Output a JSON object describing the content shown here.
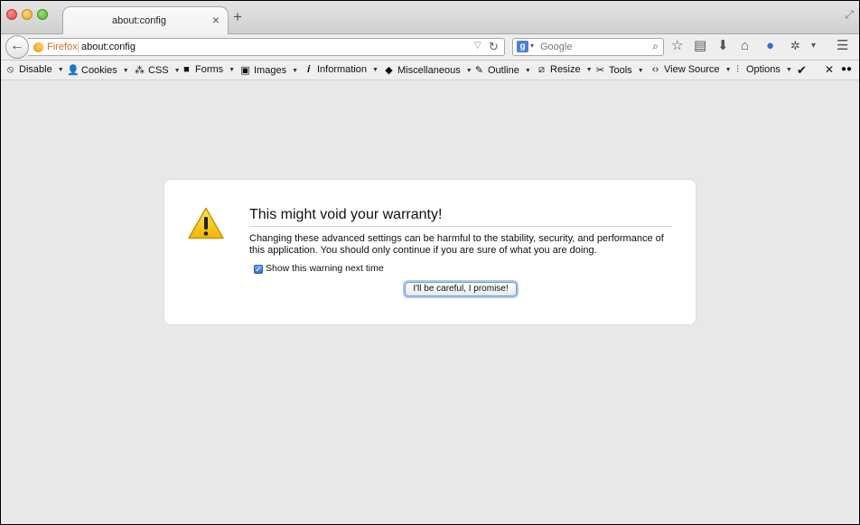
{
  "tab": {
    "title": "about:config",
    "close": "×",
    "new_tab": "+"
  },
  "navbar": {
    "back": "←",
    "identity_label": "Firefox",
    "url": "about:config",
    "url_dropdown": "▽",
    "reload": "↻",
    "search_engine_letter": "g",
    "search_engine_dropdown": "▾",
    "search_placeholder": "Google",
    "search_icon": "⌕",
    "bookmark_star": "☆",
    "bookmarks_menu": "▤",
    "downloads": "⬇",
    "home": "⌂",
    "sync": "●",
    "addon": "✲",
    "addon_dropdown": "▾",
    "menu": "☰"
  },
  "devtoolbar": {
    "items": [
      {
        "label": "Disable",
        "icon": "⦸",
        "dd": "▼"
      },
      {
        "label": "Cookies",
        "icon": "👤",
        "dd": "▼"
      },
      {
        "label": "CSS",
        "icon": "⁂",
        "dd": "▼"
      },
      {
        "label": "Forms",
        "icon": "■",
        "dd": "▼"
      },
      {
        "label": "Images",
        "icon": "▣",
        "dd": "▼"
      },
      {
        "label": "Information",
        "icon": "𝒊",
        "dd": "▼"
      },
      {
        "label": "Miscellaneous",
        "icon": "◆",
        "dd": "▼"
      },
      {
        "label": "Outline",
        "icon": "✎",
        "dd": "▼"
      },
      {
        "label": "Resize",
        "icon": "⧄",
        "dd": "▼"
      },
      {
        "label": "Tools",
        "icon": "✂",
        "dd": "▼"
      },
      {
        "label": "View Source",
        "icon": "‹›",
        "dd": "▼"
      },
      {
        "label": "Options",
        "icon": "⫶",
        "dd": "▼"
      }
    ],
    "check": "✔",
    "close": "✕"
  },
  "dialog": {
    "title": "This might void your warranty!",
    "body": "Changing these advanced settings can be harmful to the stability, security, and performance of this application. You should only continue if you are sure of what you are doing.",
    "checkbox_label": "Show this warning next time",
    "checkbox_checked": true,
    "button": "I'll be careful, I promise!"
  },
  "colors": {
    "accent": "#2f72d6",
    "warning": "#f5c400"
  }
}
